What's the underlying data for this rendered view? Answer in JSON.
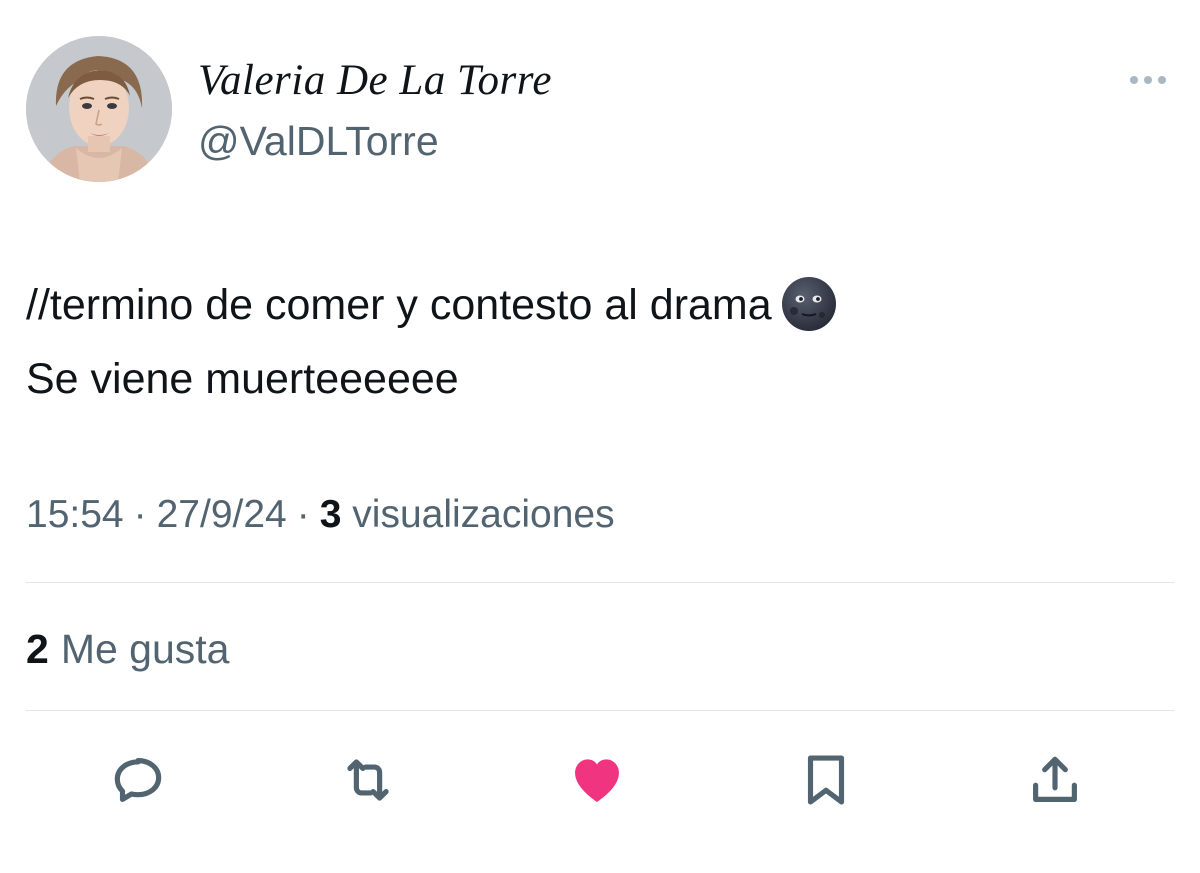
{
  "author": {
    "display_name": "Valeria De La Torre",
    "handle": "@ValDLTorre",
    "avatar_icon": "avatar-photo"
  },
  "menu": {
    "icon": "more-horizontal-icon"
  },
  "tweet": {
    "line1": "//termino de comer y contesto al drama",
    "line1_emoji": "new-moon-face-emoji",
    "line2": "Se viene muerteeeeee"
  },
  "meta": {
    "time": "15:54",
    "separator": "·",
    "date": "27/9/24",
    "views_count": "3",
    "views_label": "visualizaciones"
  },
  "stats": {
    "likes_count": "2",
    "likes_label": "Me gusta"
  },
  "actions": [
    {
      "name": "reply",
      "icon": "reply-icon"
    },
    {
      "name": "retweet",
      "icon": "retweet-icon"
    },
    {
      "name": "like",
      "icon": "heart-filled-icon",
      "active": true
    },
    {
      "name": "bookmark",
      "icon": "bookmark-icon"
    },
    {
      "name": "share",
      "icon": "share-icon"
    }
  ],
  "colors": {
    "text_primary": "#0f1419",
    "text_secondary": "#536471",
    "like_active": "#f0347f",
    "divider": "#e1e4e7"
  }
}
